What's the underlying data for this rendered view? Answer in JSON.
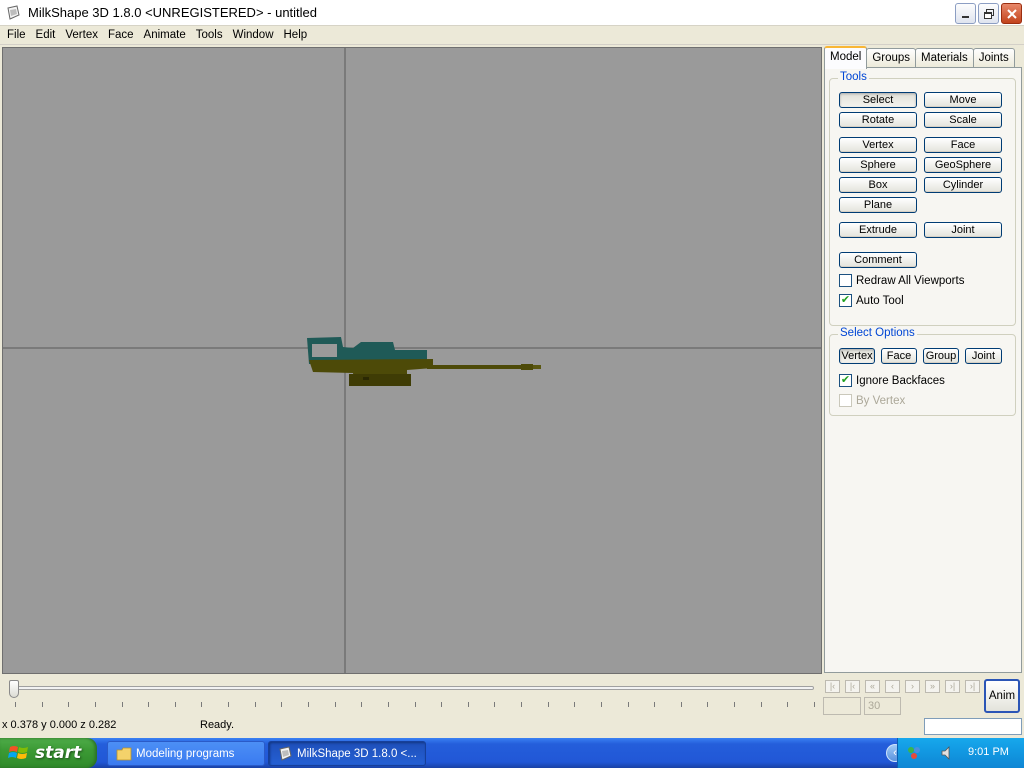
{
  "window": {
    "title": "MilkShape 3D 1.8.0 <UNREGISTERED> - untitled",
    "controls": [
      "minimize",
      "restore",
      "close"
    ]
  },
  "menu": [
    "File",
    "Edit",
    "Vertex",
    "Face",
    "Animate",
    "Tools",
    "Window",
    "Help"
  ],
  "panel": {
    "tabs": [
      "Model",
      "Groups",
      "Materials",
      "Joints"
    ],
    "active_tab": "Model",
    "tools": {
      "title": "Tools",
      "select": "Select",
      "move": "Move",
      "rotate": "Rotate",
      "scale": "Scale",
      "vertex": "Vertex",
      "face": "Face",
      "sphere": "Sphere",
      "geosphere": "GeoSphere",
      "box": "Box",
      "cylinder": "Cylinder",
      "plane": "Plane",
      "extrude": "Extrude",
      "joint": "Joint",
      "comment": "Comment",
      "redraw_all": "Redraw All Viewports",
      "redraw_all_checked": false,
      "auto_tool": "Auto Tool",
      "auto_tool_checked": true
    },
    "select_options": {
      "title": "Select Options",
      "vertex": "Vertex",
      "face": "Face",
      "group": "Group",
      "joint": "Joint",
      "ignore_backfaces": "Ignore Backfaces",
      "ignore_backfaces_checked": true,
      "by_vertex": "By Vertex",
      "by_vertex_checked": false
    }
  },
  "animation": {
    "frame_current": "",
    "frame_total": "30",
    "anim_button": "Anim"
  },
  "status": {
    "coords": "x 0.378 y 0.000 z 0.282",
    "message": "Ready."
  },
  "taskbar": {
    "start": "start",
    "items": [
      "Modeling programs",
      "MilkShape 3D 1.8.0 <..."
    ],
    "clock": "9:01 PM"
  },
  "colors": {
    "viewport_bg": "#9a9a9a",
    "model_teal": "#1f5a57",
    "model_olive": "#4d4a08",
    "group_title": "#0046d5"
  }
}
